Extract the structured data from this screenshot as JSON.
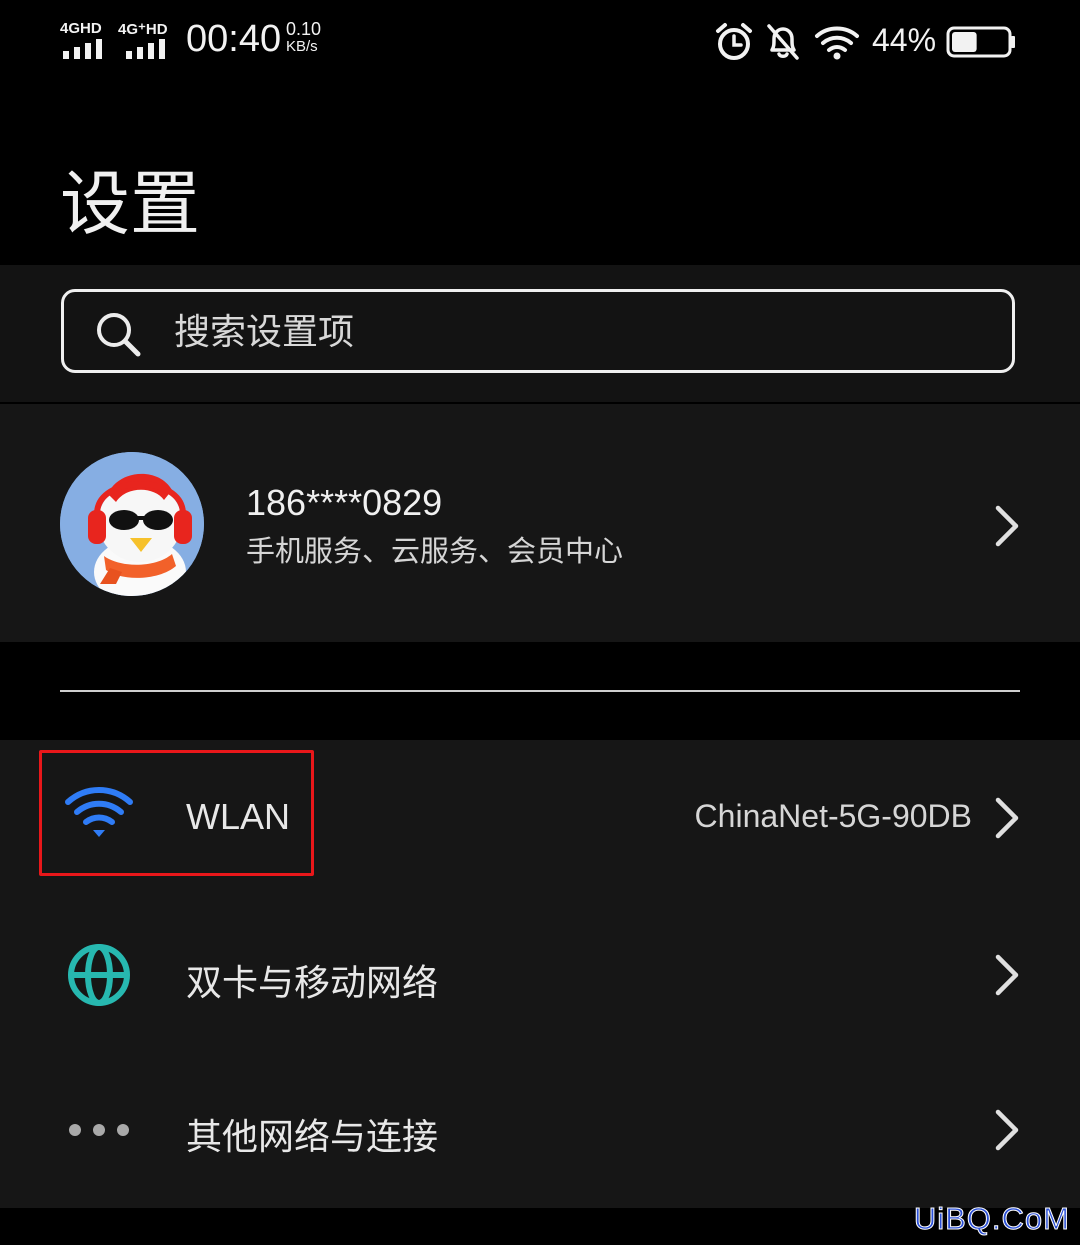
{
  "status_bar": {
    "sim1_label": "4GHD",
    "sim2_label": "4G⁺HD",
    "time": "00:40",
    "speed_value": "0.10",
    "speed_unit": "KB/s",
    "battery_percent": "44%",
    "battery_level": 0.44
  },
  "page": {
    "title": "设置"
  },
  "search": {
    "placeholder": "搜索设置项"
  },
  "account": {
    "number": "186****0829",
    "subtitle": "手机服务、云服务、会员中心"
  },
  "settings": {
    "items": [
      {
        "label": "WLAN",
        "value": "ChinaNet-5G-90DB",
        "icon": "wifi-icon"
      },
      {
        "label": "双卡与移动网络",
        "value": "",
        "icon": "globe-icon"
      },
      {
        "label": "其他网络与连接",
        "value": "",
        "icon": "more-dots-icon"
      }
    ]
  },
  "watermark": {
    "text": "UiBQ.CoM"
  },
  "colors": {
    "background": "#000000",
    "card": "#161616",
    "wifi_accent": "#2f7cf6",
    "globe_accent": "#27b8b0",
    "highlight": "#e8171a",
    "watermark": "#2a4fd6"
  }
}
